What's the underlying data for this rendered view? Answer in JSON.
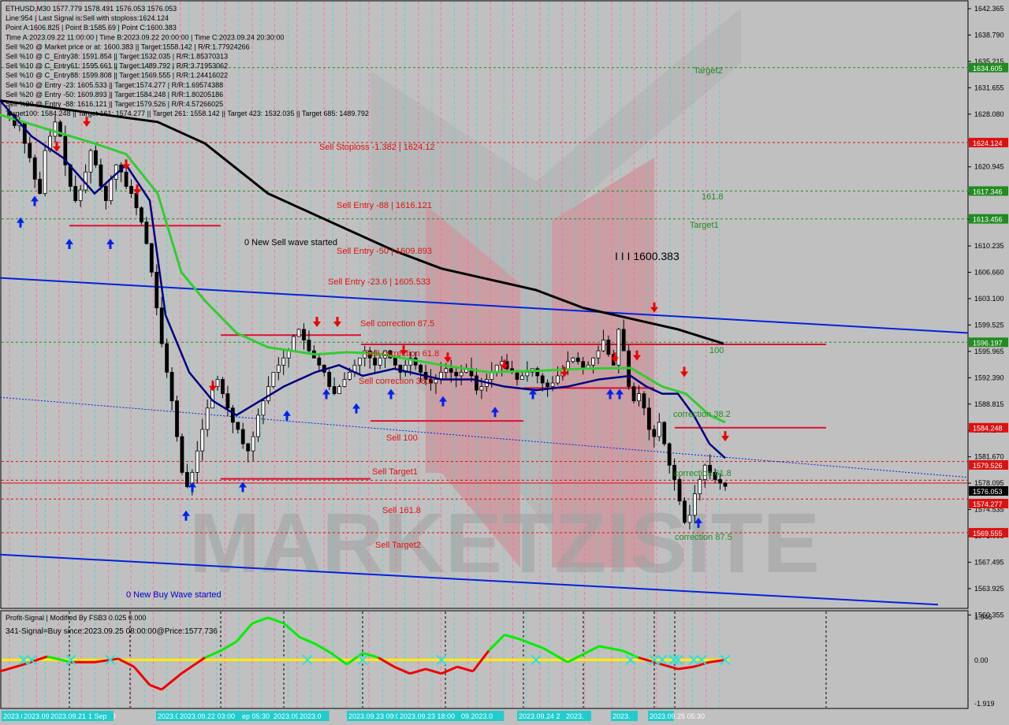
{
  "window": {
    "colors": {
      "background": "#c0c0c0",
      "grid": "#000000"
    }
  },
  "header": {
    "lines": [
      "ETHUSD,M30  1577.779 1578.491 1576.053 1576.053",
      "Line:954 | Last Signal is:Sell with stoploss:1624.124",
      "Point A:1606.825 | Point B:1585.69 | Point C:1600.383",
      "Time A:2023.09.22 11:00:00 | Time B:2023.09.22 20:00:00 | Time C:2023.09.24 20:30:00",
      "Sell %20 @ Market price or at: 1600.383 || Target:1558.142 | R/R:1.77924266",
      "Sell %10 @ C_Entry38: 1591.854 || Target:1532.035 | R/R:1.85370313",
      "Sell %10 @ C_Entry61: 1595.661 || Target:1489.792 | R/R:3.71953062",
      "Sell %10 @ C_Entry88: 1599.808 || Target:1569.555 | R/R:1.24416022",
      "Sell %10 @ Entry -23: 1605.533 || Target:1574.277 | R/R:1.69574388",
      "Sell %20 @ Entry -50: 1609.893 || Target:1584.248 | R/R:1.80205186",
      "Sell %20 @ Entry -88: 1616.121 || Target:1579.526 | R/R:4.57266025",
      "Target100: 1584.248 || Target 161: 1574.277 || Target 261: 1558.142 || Target 423: 1532.035 || Target 685: 1489.792"
    ]
  },
  "price_axis": {
    "ticks": [
      "1642.365",
      "1638.790",
      "1635.215",
      "1631.655",
      "1628.080",
      "1624.520",
      "1620.945",
      "1617.385",
      "1613.810",
      "1610.235",
      "1606.660",
      "1603.100",
      "1599.525",
      "1595.965",
      "1592.390",
      "1588.815",
      "1585.245",
      "1581.670",
      "1578.095",
      "1574.535",
      "1571.065",
      "1567.495",
      "1563.925",
      "1560.355"
    ],
    "badges": [
      {
        "label": "1634.605",
        "value": 1634.605,
        "color": "#228b22"
      },
      {
        "label": "1624.124",
        "value": 1624.124,
        "color": "#dd1111"
      },
      {
        "label": "1617.346",
        "value": 1617.346,
        "color": "#228b22"
      },
      {
        "label": "1613.456",
        "value": 1613.456,
        "color": "#228b22"
      },
      {
        "label": "1596.197",
        "value": 1596.197,
        "color": "#228b22"
      },
      {
        "label": "1584.248",
        "value": 1584.248,
        "color": "#dd1111"
      },
      {
        "label": "1579.526",
        "value": 1579.526,
        "color": "#dd1111"
      },
      {
        "label": "1576.053",
        "value": 1576.053,
        "color": "#000000"
      },
      {
        "label": "1574.277",
        "value": 1574.277,
        "color": "#dd1111"
      },
      {
        "label": "1569.555",
        "value": 1569.555,
        "color": "#dd1111"
      }
    ]
  },
  "levels": [
    {
      "label": "Target2",
      "value": 1634.605,
      "color": "#228b22"
    },
    {
      "label": "Sell Stoploss -1.382 | 1624.12",
      "value": 1624.124,
      "color": "#dd1111"
    },
    {
      "label": "161.8",
      "value": 1617.346,
      "color": "#228b22"
    },
    {
      "label": "Sell Entry -88 | 1616.121",
      "value": 1616.121,
      "color": "#dd1111"
    },
    {
      "label": "Target1",
      "value": 1613.456,
      "color": "#228b22"
    },
    {
      "label": "Sell Entry -50 | 1609.893",
      "value": 1609.893,
      "color": "#dd1111"
    },
    {
      "label": "Sell Entry -23.6 | 1605.533",
      "value": 1605.533,
      "color": "#dd1111"
    },
    {
      "label": "Sell correction 87.5",
      "value": 1599.808,
      "color": "#dd1111"
    },
    {
      "label": "100",
      "value": 1596.197,
      "color": "#228b22"
    },
    {
      "label": "Sell correction 61.8",
      "value": 1595.661,
      "color": "#dd1111"
    },
    {
      "label": "Sell correction 38.2",
      "value": 1591.854,
      "color": "#dd1111"
    },
    {
      "label": "correction 38.2",
      "value": 1587.5,
      "color": "#228b22"
    },
    {
      "label": "Sell 100",
      "value": 1584.248,
      "color": "#dd1111"
    },
    {
      "label": "Sell Target1",
      "value": 1579.526,
      "color": "#dd1111"
    },
    {
      "label": "correction 61.8",
      "value": 1578.2,
      "color": "#228b22"
    },
    {
      "label": "Sell 161.8",
      "value": 1574.277,
      "color": "#dd1111"
    },
    {
      "label": "correction 87.5",
      "value": 1569.9,
      "color": "#228b22"
    },
    {
      "label": "Sell Target2",
      "value": 1569.555,
      "color": "#dd1111"
    }
  ],
  "annotations": {
    "new_sell_wave": "0 New Sell wave started",
    "new_buy_wave": "0 New Buy Wave started",
    "point_c_label": "I I I 1600.383",
    "watermark": "MARKETZISITE"
  },
  "indicator": {
    "title": "Profit-Signal | Modified By FSB3 0.025 0.000",
    "signal": "341-Signal=Buy since:2023.09.25 08:00:00@Price:1577.736",
    "axis_ticks": [
      "1.946",
      "0.00",
      "-1.919"
    ]
  },
  "time_axis": {
    "labels": [
      "2023.0",
      "2023.09.21",
      "2023.09.21 07:30:30",
      "1 Sep",
      "2023.09.21 23:00",
      "2023.09.22 03:00",
      "ep 05:30",
      "2023.09.22 1",
      "2023.0",
      "2023.09.23 09:00",
      "2023.09.23 18:00",
      "09.2023.0",
      "2023.09.24 2",
      "2023.",
      "2023.",
      "2023.09.25 05:30"
    ]
  },
  "chart_data": {
    "type": "candlestick",
    "symbol": "ETHUSD",
    "timeframe": "M30",
    "ylim": [
      1559.2,
      1643.4
    ],
    "close_path": [
      1628,
      1626.5,
      1627,
      1624,
      1622,
      1619,
      1617,
      1623,
      1625,
      1627,
      1625,
      1621,
      1618,
      1616,
      1617.5,
      1620,
      1623,
      1621,
      1618,
      1616,
      1619,
      1621,
      1620,
      1618,
      1617,
      1615,
      1613,
      1610,
      1606,
      1601,
      1596,
      1592,
      1588,
      1583,
      1578,
      1576,
      1578,
      1581,
      1584,
      1587,
      1590,
      1591,
      1589,
      1587,
      1585,
      1584,
      1582,
      1581,
      1583,
      1586,
      1588,
      1590,
      1592,
      1593,
      1594,
      1595,
      1597,
      1598,
      1596.5,
      1595,
      1594,
      1593,
      1592,
      1590,
      1589,
      1590,
      1591,
      1592,
      1593,
      1594,
      1595,
      1594,
      1593,
      1594,
      1595,
      1594,
      1593,
      1592,
      1593,
      1594,
      1593,
      1592,
      1591,
      1590.5,
      1591,
      1592,
      1592.5,
      1592,
      1591.5,
      1592,
      1592.5,
      1591.5,
      1589.5,
      1590,
      1591,
      1592,
      1593,
      1593.5,
      1592.5,
      1592,
      1591,
      1591.5,
      1592,
      1592.5,
      1591.5,
      1590.5,
      1590,
      1590.5,
      1591.5,
      1592.5,
      1593.5,
      1594,
      1593.5,
      1592.5,
      1593,
      1594,
      1595,
      1596.5,
      1594.5,
      1593,
      1598,
      1595,
      1590,
      1588,
      1589,
      1587,
      1584,
      1583,
      1585,
      1582,
      1579,
      1577,
      1574,
      1571,
      1572,
      1575,
      1577,
      1579,
      1578,
      1577,
      1576.5,
      1576.053
    ],
    "close_path_x": [
      12,
      920
    ],
    "sma_long": [
      [
        0,
        1630
      ],
      [
        100,
        1628.5
      ],
      [
        200,
        1627
      ],
      [
        260,
        1624
      ],
      [
        340,
        1617
      ],
      [
        420,
        1613
      ],
      [
        500,
        1609
      ],
      [
        560,
        1606.5
      ],
      [
        620,
        1605
      ],
      [
        680,
        1603.5
      ],
      [
        740,
        1601
      ],
      [
        800,
        1599.5
      ],
      [
        860,
        1598
      ],
      [
        918,
        1596
      ]
    ],
    "sma_mid": [
      [
        0,
        1628
      ],
      [
        60,
        1626
      ],
      [
        120,
        1624
      ],
      [
        160,
        1622.5
      ],
      [
        200,
        1617
      ],
      [
        230,
        1606
      ],
      [
        260,
        1602
      ],
      [
        300,
        1597.5
      ],
      [
        340,
        1595.5
      ],
      [
        400,
        1594.5
      ],
      [
        440,
        1594.8
      ],
      [
        480,
        1594.6
      ],
      [
        560,
        1593
      ],
      [
        620,
        1592
      ],
      [
        680,
        1592.2
      ],
      [
        740,
        1592.5
      ],
      [
        800,
        1592.6
      ],
      [
        840,
        1590
      ],
      [
        870,
        1589
      ],
      [
        900,
        1586
      ],
      [
        920,
        1585
      ]
    ],
    "sma_fast": [
      [
        0,
        1630
      ],
      [
        40,
        1625
      ],
      [
        80,
        1622
      ],
      [
        120,
        1617
      ],
      [
        160,
        1621
      ],
      [
        190,
        1616
      ],
      [
        210,
        1600
      ],
      [
        240,
        1592
      ],
      [
        270,
        1588
      ],
      [
        300,
        1586
      ],
      [
        330,
        1588
      ],
      [
        360,
        1590
      ],
      [
        400,
        1592
      ],
      [
        430,
        1593
      ],
      [
        460,
        1591.5
      ],
      [
        500,
        1592.5
      ],
      [
        560,
        1591
      ],
      [
        600,
        1591
      ],
      [
        640,
        1590
      ],
      [
        680,
        1589.5
      ],
      [
        720,
        1590
      ],
      [
        760,
        1591
      ],
      [
        800,
        1591.5
      ],
      [
        820,
        1590
      ],
      [
        840,
        1589
      ],
      [
        860,
        1589
      ],
      [
        880,
        1586
      ],
      [
        900,
        1582
      ],
      [
        920,
        1580
      ]
    ],
    "trend_upper": [
      [
        0,
        1605.2
      ],
      [
        1228,
        1597.5
      ]
    ],
    "trend_lower": [
      [
        0,
        1566.5
      ],
      [
        1190,
        1559.5
      ]
    ],
    "trend_dotted": [
      [
        0,
        1588.5
      ],
      [
        1228,
        1577.3
      ]
    ],
    "zones": [
      {
        "x1": 88,
        "x2": 280,
        "value": 1612.5
      },
      {
        "x1": 280,
        "x2": 458,
        "value": 1597.2
      },
      {
        "x1": 458,
        "x2": 1048,
        "value": 1595.9
      },
      {
        "x1": 470,
        "x2": 664,
        "value": 1585.2
      },
      {
        "x1": 664,
        "x2": 830,
        "value": 1589.8
      },
      {
        "x1": 856,
        "x2": 1048,
        "value": 1584.248
      },
      {
        "x1": 280,
        "x2": 470,
        "value": 1577.1
      }
    ],
    "sell_arrows": [
      [
        72,
        1622.5
      ],
      [
        110,
        1626
      ],
      [
        160,
        1620
      ],
      [
        174,
        1616.5
      ],
      [
        270,
        1589
      ],
      [
        402,
        1598
      ],
      [
        428,
        1598
      ],
      [
        512,
        1594
      ],
      [
        568,
        1593
      ],
      [
        640,
        1592
      ],
      [
        716,
        1591
      ],
      [
        780,
        1593
      ],
      [
        808,
        1593.3
      ],
      [
        830,
        1600
      ],
      [
        868,
        1591
      ],
      [
        920,
        1582
      ]
    ],
    "buy_arrows": [
      [
        26,
        1614
      ],
      [
        44,
        1617
      ],
      [
        88,
        1611
      ],
      [
        140,
        1611
      ],
      [
        244,
        1577
      ],
      [
        236,
        1573
      ],
      [
        308,
        1577
      ],
      [
        364,
        1587
      ],
      [
        414,
        1590
      ],
      [
        452,
        1588
      ],
      [
        496,
        1590
      ],
      [
        562,
        1589
      ],
      [
        628,
        1587.5
      ],
      [
        676,
        1590
      ],
      [
        774,
        1590
      ],
      [
        786,
        1590
      ],
      [
        886,
        1572
      ]
    ],
    "oscillator": {
      "ylim": [
        -1.919,
        1.946
      ],
      "series": [
        [
          0,
          -0.5
        ],
        [
          30,
          -0.2
        ],
        [
          60,
          0.15
        ],
        [
          90,
          -0.1
        ],
        [
          120,
          -0.1
        ],
        [
          150,
          0.05
        ],
        [
          170,
          -0.3
        ],
        [
          190,
          -1.1
        ],
        [
          205,
          -1.3
        ],
        [
          230,
          -0.6
        ],
        [
          260,
          0.1
        ],
        [
          280,
          0.4
        ],
        [
          300,
          0.8
        ],
        [
          320,
          1.6
        ],
        [
          340,
          1.85
        ],
        [
          360,
          1.6
        ],
        [
          380,
          1.0
        ],
        [
          400,
          0.7
        ],
        [
          420,
          0.3
        ],
        [
          440,
          -0.2
        ],
        [
          460,
          0.3
        ],
        [
          480,
          0.1
        ],
        [
          500,
          -0.3
        ],
        [
          520,
          -0.6
        ],
        [
          540,
          -0.4
        ],
        [
          560,
          -0.6
        ],
        [
          580,
          -0.3
        ],
        [
          600,
          -0.5
        ],
        [
          620,
          0.4
        ],
        [
          640,
          1.1
        ],
        [
          660,
          0.9
        ],
        [
          690,
          0.5
        ],
        [
          720,
          -0.1
        ],
        [
          760,
          0.6
        ],
        [
          790,
          0.4
        ],
        [
          810,
          0.1
        ],
        [
          840,
          -0.2
        ],
        [
          860,
          -0.4
        ],
        [
          880,
          -0.3
        ],
        [
          900,
          -0.1
        ],
        [
          920,
          0.0
        ]
      ],
      "zero_line": 0.0
    }
  }
}
